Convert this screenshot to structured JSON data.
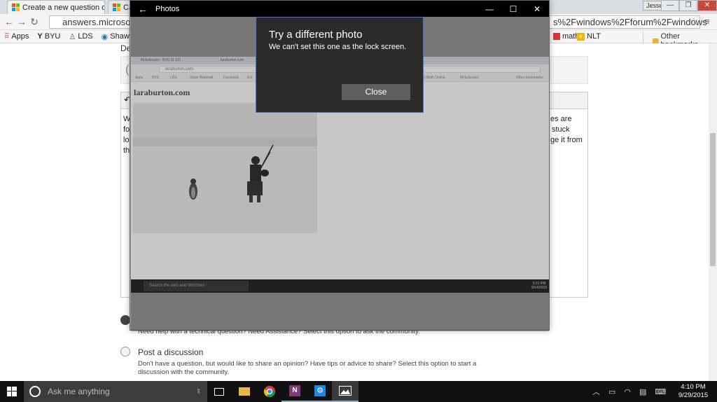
{
  "browser": {
    "tabs": [
      {
        "label": "Create a new question or"
      },
      {
        "label": "Ca"
      }
    ],
    "user": "Jesse",
    "window_controls": [
      "—",
      "❐",
      "✕"
    ],
    "address": "answers.microsoft",
    "address_tail": "s%2Fwindows%2Fforum%2Fwindows",
    "bookmarks": [
      {
        "label": "Apps"
      },
      {
        "label": "BYU"
      },
      {
        "label": "LDS"
      },
      {
        "label": "Shaw We"
      },
      {
        "label": "math"
      },
      {
        "label": "NLT"
      },
      {
        "label": "Other bookmarks"
      }
    ]
  },
  "page": {
    "label_fragment": "De",
    "text_left": [
      "W",
      "fo",
      "lo",
      "th"
    ],
    "text_right": [
      "es are",
      "stuck",
      "ge it from"
    ],
    "option_question_help": "Need help with a technical question? Need Assistance? Select this option to ask the community.",
    "option_discussion": {
      "label": "Post a discussion",
      "help": "Don't have a question, but would like to share an opinion? Have tips or advice to share? Select this option to start a discussion with the community."
    }
  },
  "photos_app": {
    "title": "Photos",
    "preview": {
      "site": "laraburton.com",
      "address": "laraburton.com",
      "taskbar_search": "Search the web and Windows",
      "time": "5:21 PM",
      "date": "9/14/2015",
      "tabs": [
        "MyEducator - BYU IS 110",
        "laraburton.com"
      ],
      "bookmarks": [
        "Apps",
        "BYU",
        "LDS",
        "Shaw Webmail",
        "Facebook",
        "Ent",
        "BYU Math Online",
        "MyEducator",
        "Other bookmarks"
      ]
    }
  },
  "dialog": {
    "title": "Try a different photo",
    "message": "We can't set this one as the lock screen.",
    "close_label": "Close"
  },
  "taskbar": {
    "search_placeholder": "Ask me anything",
    "time": "4:10 PM",
    "date": "9/29/2015"
  },
  "colors": {
    "taskbar": "#101010",
    "dialog_bg": "#2b2b2b",
    "dialog_border": "#3c78d8",
    "photos_titlebar": "#000000"
  }
}
